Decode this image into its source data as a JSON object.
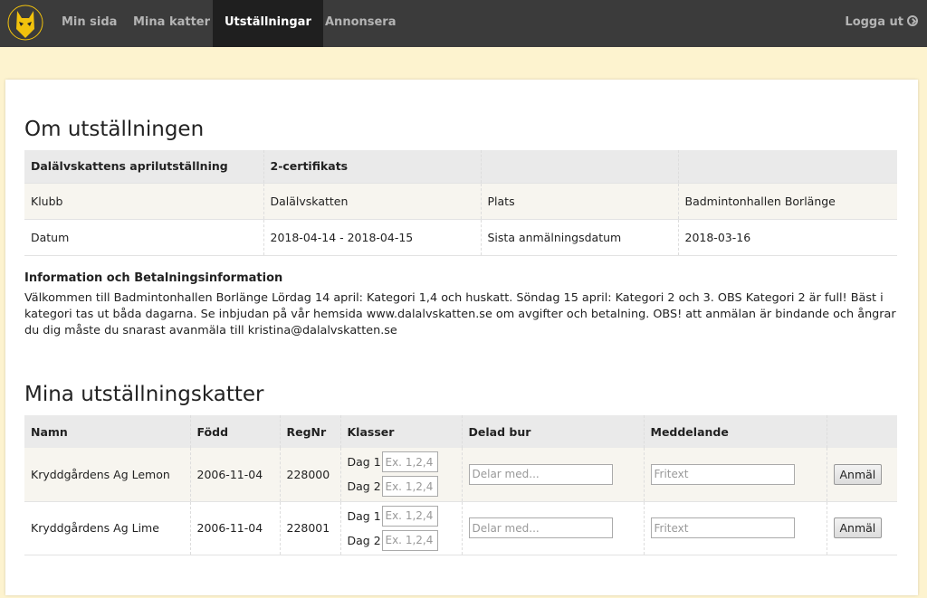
{
  "nav": {
    "items": [
      {
        "label": "Min sida",
        "active": false
      },
      {
        "label": "Mina katter",
        "active": false
      },
      {
        "label": "Utställningar",
        "active": true
      },
      {
        "label": "Annonsera",
        "active": false
      }
    ],
    "logout_label": "Logga ut",
    "logout_icon": "logout-circle-arrow-icon"
  },
  "about": {
    "title": "Om utställningen",
    "header": [
      "Dalälvskattens aprilutställning",
      "2-certifikats",
      "",
      ""
    ],
    "rows": [
      [
        "Klubb",
        "Dalälvskatten",
        "Plats",
        "Badmintonhallen Borlänge"
      ],
      [
        "Datum",
        "2018-04-14 - 2018-04-15",
        "Sista anmälningsdatum",
        "2018-03-16"
      ]
    ],
    "info_heading": "Information och Betalningsinformation",
    "info_text": "Välkommen till Badmintonhallen Borlänge Lördag 14 april: Kategori 1,4 och huskatt. Söndag 15 april: Kategori 2 och 3. OBS Kategori 2 är full! Bäst i kategori tas ut båda dagarna. Se inbjudan på vår hemsida www.dalalvskatten.se om avgifter och betalning. OBS! att anmälan är bindande och ångrar du dig måste du snarast avanmäla till kristina@dalalvskatten.se"
  },
  "cats": {
    "title": "Mina utställningskatter",
    "columns": [
      "Namn",
      "Född",
      "RegNr",
      "Klasser",
      "Delad bur",
      "Meddelande",
      ""
    ],
    "day1_label": "Dag 1",
    "day2_label": "Dag 2",
    "class_placeholder": "Ex. 1,2,4",
    "shared_placeholder": "Delar med...",
    "message_placeholder": "Fritext",
    "button_label": "Anmäl",
    "rows": [
      {
        "name": "Kryddgårdens Ag Lemon",
        "born": "2006-11-04",
        "regnr": "228000"
      },
      {
        "name": "Kryddgårdens Ag Lime",
        "born": "2006-11-04",
        "regnr": "228001"
      }
    ]
  },
  "colors": {
    "navbar": "#3b3b3b",
    "active_tab": "#1f1f1f",
    "page_bg": "#fdf3cf",
    "logo_yellow": "#f2c20c"
  }
}
